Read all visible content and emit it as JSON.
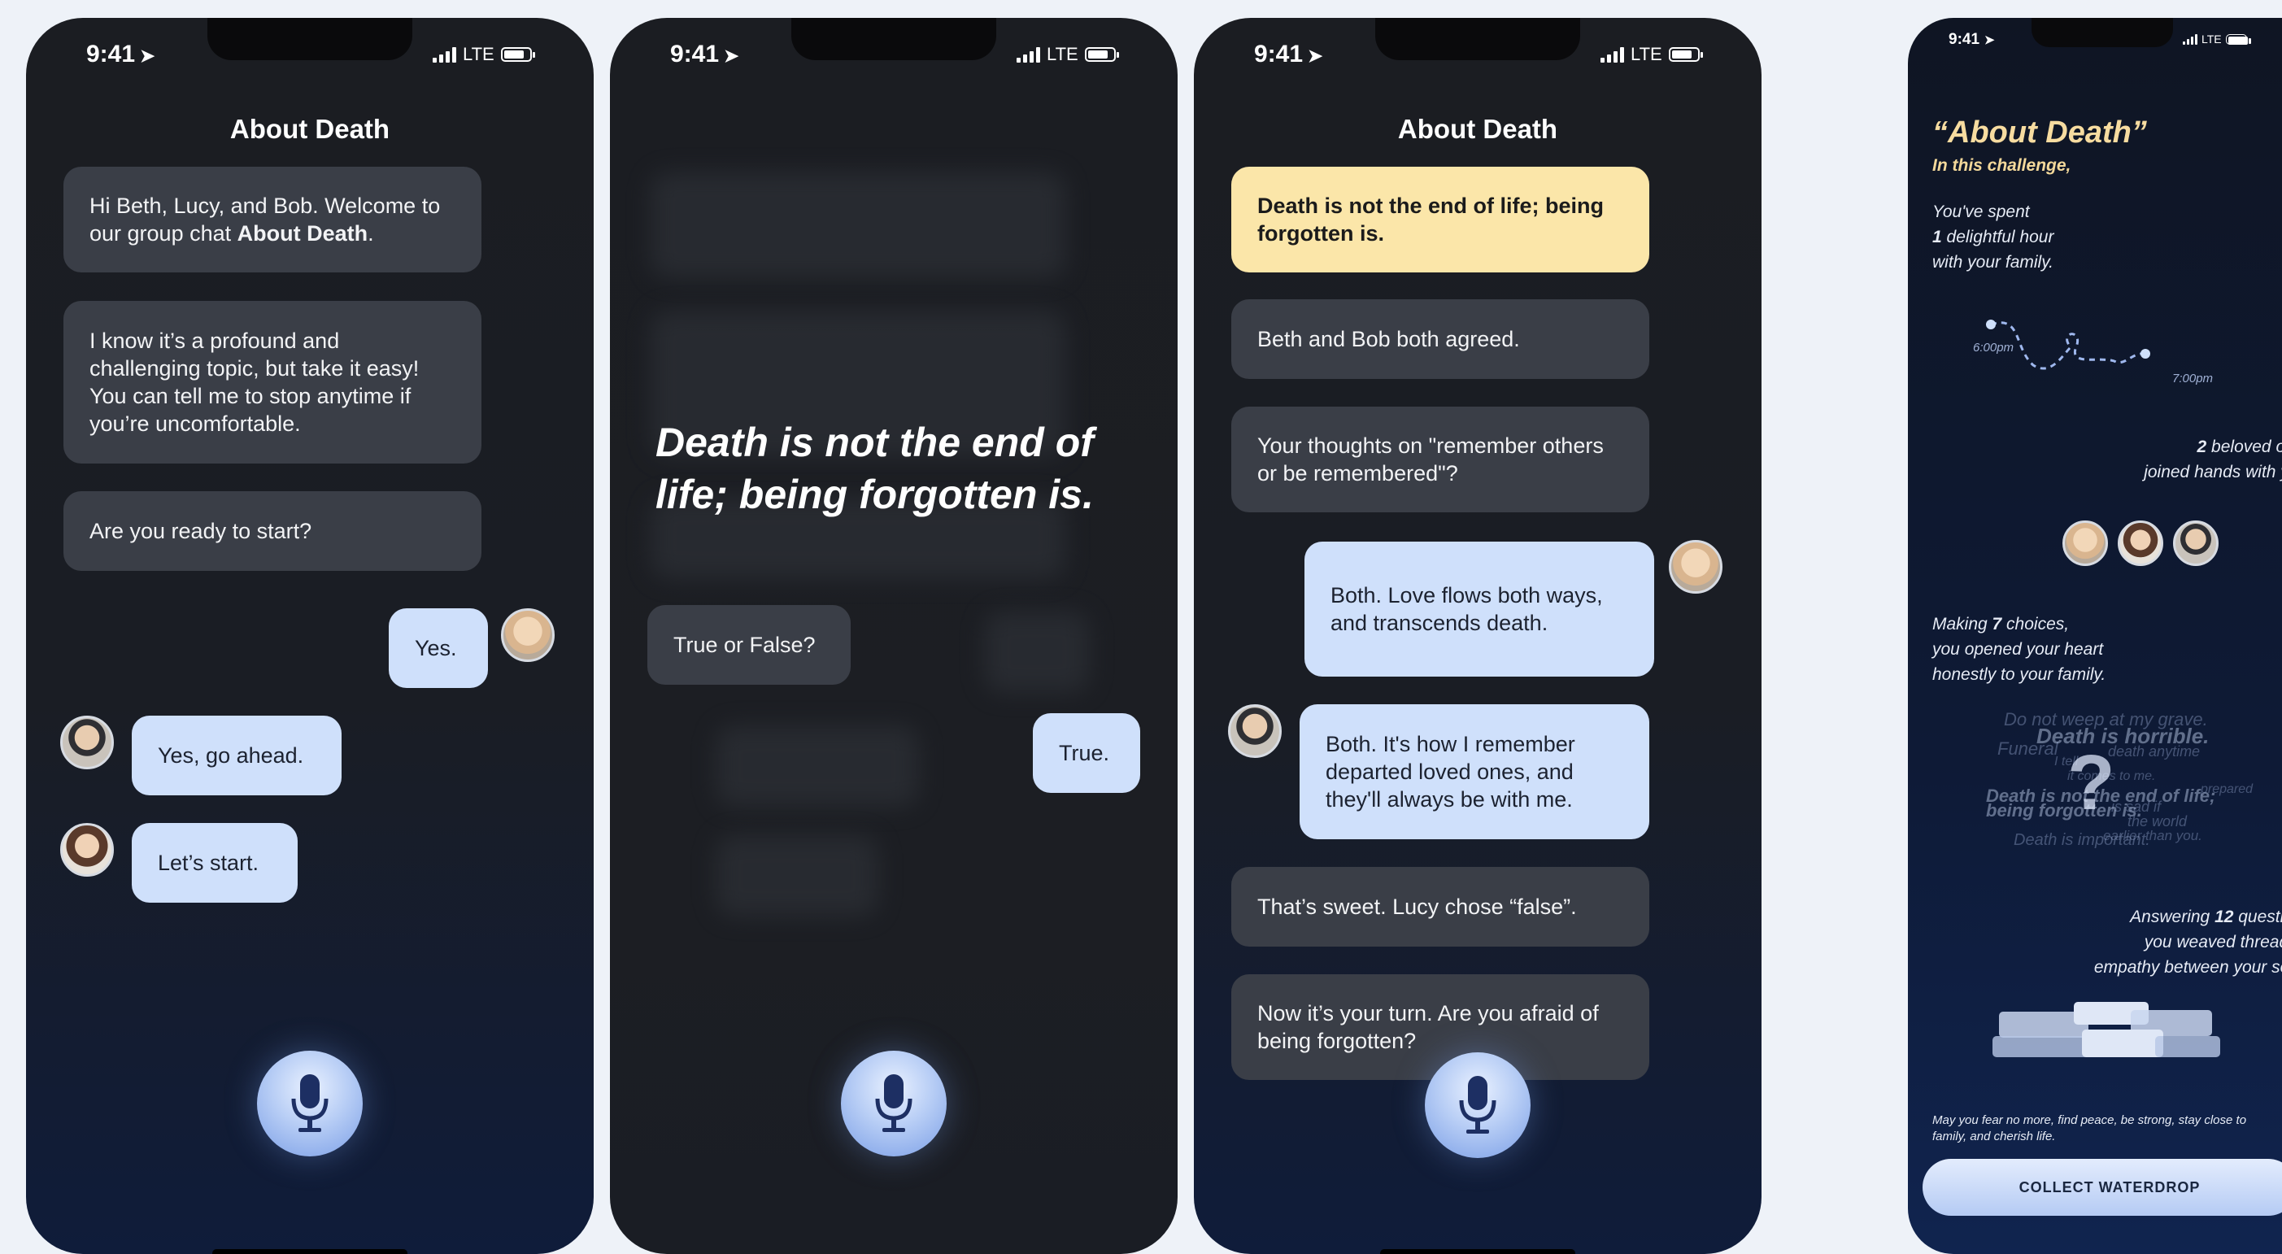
{
  "status": {
    "time": "9:41",
    "carrier": "LTE"
  },
  "screen1": {
    "title": "About Death",
    "msg1_part1": "Hi Beth, Lucy, and Bob. Welcome to our group chat ",
    "msg1_bold": "About Death",
    "msg1_end": ".",
    "msg2": "I know it’s a profound and challenging topic, but take it easy! You can tell me to stop anytime if you’re uncomfortable.",
    "msg3": "Are you ready to start?",
    "reply_beth": "Yes.",
    "reply_bob": "Yes, go ahead.",
    "reply_lucy": "Let’s start."
  },
  "screen2": {
    "quote": "Death is not the end of life; being forgotten is.",
    "question": "True or False?",
    "answer": "True."
  },
  "screen3": {
    "title": "About Death",
    "statement": "Death is not the end of life; being forgotten is.",
    "msg_agreed": "Beth and Bob both agreed.",
    "msg_question": "Your thoughts on \"remember others or be remembered\"?",
    "reply_beth": "Both. Love flows both ways, and transcends death.",
    "reply_bob": "Both. It's how I remember departed loved ones, and they'll always be with me.",
    "msg_lucy": "That’s sweet. Lucy chose “false”.",
    "msg_turn": "Now it’s your turn. Are you afraid of being forgotten?"
  },
  "screen4": {
    "title": "“About Death”",
    "subtitle": "In this challenge,",
    "spent_1": "You've spent",
    "spent_num": "1",
    "spent_2": " delightful hour",
    "spent_3": "with your family.",
    "time_start": "6:00pm",
    "time_end": "7:00pm",
    "beloved_num": "2",
    "beloved_1": " beloved ones",
    "beloved_2": "joined hands with you.",
    "choices_1": "Making ",
    "choices_num": "7",
    "choices_2": " choices,",
    "choices_3": "you opened your heart",
    "choices_4": "honestly to your family.",
    "cloud": [
      "Do not weep at my grave.",
      "Death is horrible.",
      "Funeral",
      "I tell",
      "death anytime",
      "it comes to me.",
      "Death is not the end of life;",
      "being forgotten is.",
      "Death is important.",
      "is sad if",
      "the world",
      "earlier than you.",
      "prepared"
    ],
    "answers_1": "Answering ",
    "answers_num": "12",
    "answers_2": " questions,",
    "answers_3": "you weaved threads of",
    "answers_4": "empathy between your souls.",
    "footer": "May you fear no more, find peace, be strong, stay close to family, and cherish life.",
    "button": "COLLECT WATERDROP"
  },
  "colors": {
    "user_bubble": "#cfe0fb",
    "highlight": "#fbe6a9",
    "bot_bubble": "#3a3e47",
    "accent": "#f7dca0"
  }
}
